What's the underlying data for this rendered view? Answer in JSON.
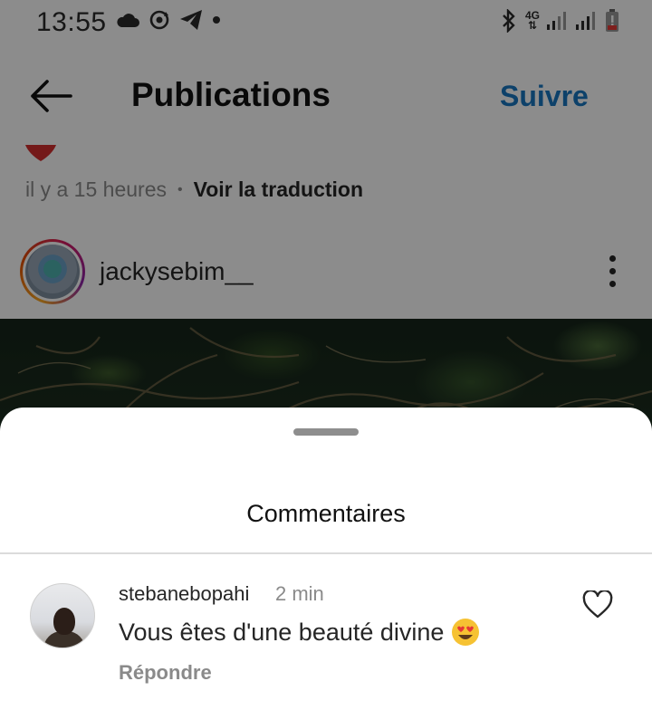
{
  "status_bar": {
    "time": "13:55",
    "network": "4G",
    "icons_left": [
      "cloud-icon",
      "sync-icon",
      "telegram-icon",
      "dot-icon"
    ],
    "icons_right": [
      "bluetooth-icon",
      "network-4g-icon",
      "signal-icon",
      "signal-icon",
      "battery-low-icon"
    ]
  },
  "header": {
    "title": "Publications",
    "follow_label": "Suivre",
    "follow_color": "#1877c2"
  },
  "post": {
    "time_ago": "il y a 15 heures",
    "separator": "•",
    "translate_label": "Voir la traduction",
    "username": "jackysebim__"
  },
  "sheet": {
    "title": "Commentaires"
  },
  "comments": [
    {
      "username": "stebanebopahi",
      "time": "2 min",
      "text": "Vous êtes d'une beauté divine",
      "emoji": "heart-eyes-emoji",
      "reply_label": "Répondre"
    }
  ]
}
